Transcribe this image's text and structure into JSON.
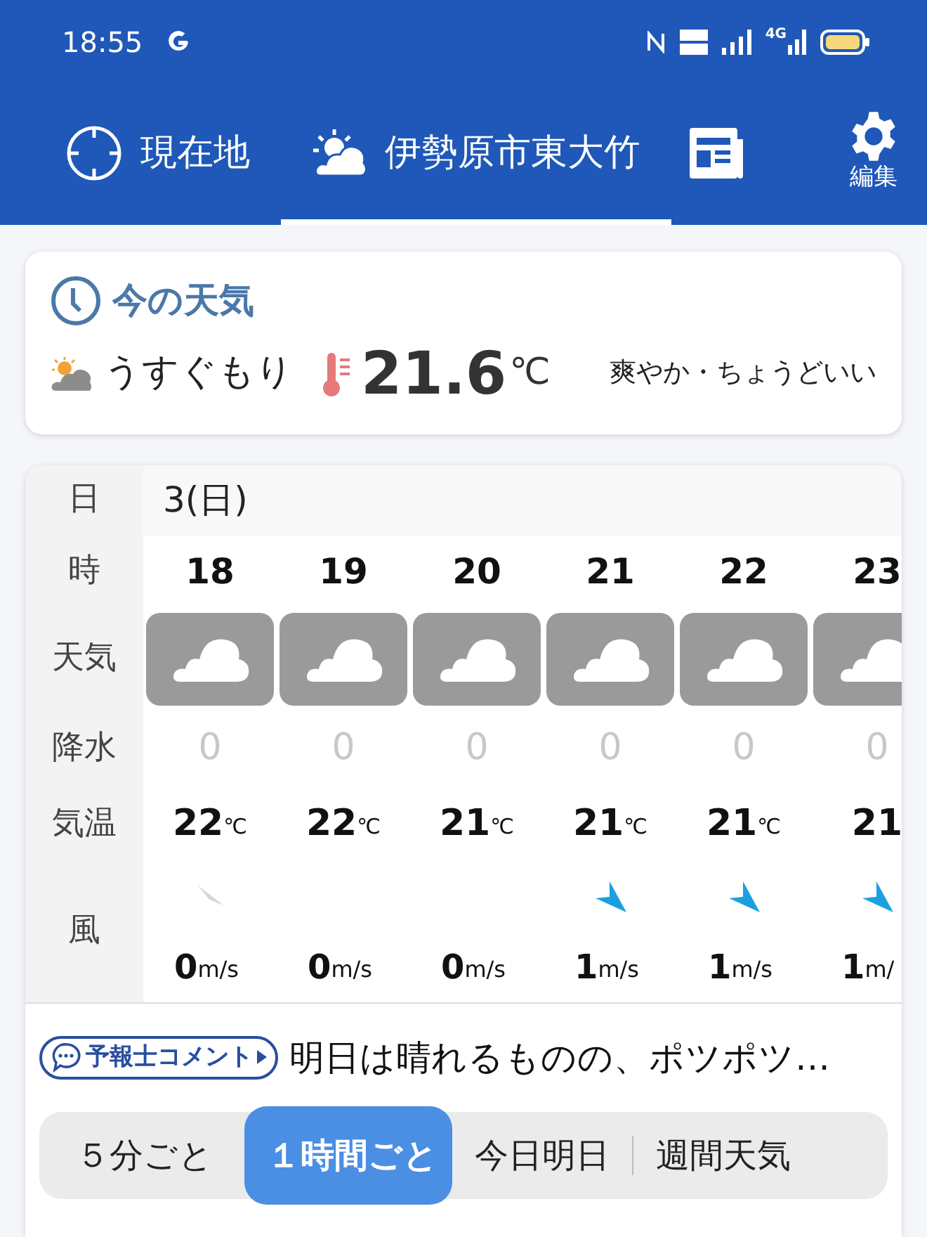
{
  "status_bar": {
    "time": "18:55",
    "network": "4G"
  },
  "tabs": [
    {
      "kind": "location",
      "label": "現在地",
      "selected": false
    },
    {
      "kind": "weather",
      "label": "伊勢原市東大竹",
      "selected": true
    },
    {
      "kind": "news",
      "selected": false
    }
  ],
  "edit_button": {
    "label": "編集"
  },
  "current": {
    "title": "今の天気",
    "condition": "うすぐもり",
    "temperature": "21.6",
    "unit": "℃",
    "feel": "爽やか・ちょうどいい"
  },
  "table": {
    "row_labels": [
      "日",
      "時",
      "天気",
      "降水",
      "気温",
      "風"
    ],
    "date": "3(日)",
    "hours": [
      {
        "hour": "18",
        "precip": "0",
        "temp": "22",
        "temp_unit": "℃",
        "kind": "calm",
        "speed": "0",
        "speed_unit": "m/s"
      },
      {
        "hour": "19",
        "precip": "0",
        "temp": "22",
        "temp_unit": "℃",
        "kind": "none",
        "speed": "0",
        "speed_unit": "m/s"
      },
      {
        "hour": "20",
        "precip": "0",
        "temp": "21",
        "temp_unit": "℃",
        "kind": "none",
        "speed": "0",
        "speed_unit": "m/s"
      },
      {
        "hour": "21",
        "precip": "0",
        "temp": "21",
        "temp_unit": "℃",
        "kind": "arrow",
        "speed": "1",
        "speed_unit": "m/s"
      },
      {
        "hour": "22",
        "precip": "0",
        "temp": "21",
        "temp_unit": "℃",
        "kind": "arrow",
        "speed": "1",
        "speed_unit": "m/s"
      },
      {
        "hour": "23",
        "precip": "0",
        "temp": "21",
        "kind": "arrow",
        "speed": "1",
        "speed_unit": "m/"
      }
    ]
  },
  "comment": {
    "badge": "予報士コメント",
    "text": "明日は晴れるものの、ポツポツ…"
  },
  "segments": [
    {
      "label": "５分ごと",
      "selected": false
    },
    {
      "label": "１時間ごと",
      "selected": true
    },
    {
      "label": "今日明日",
      "selected": false
    },
    {
      "label": "週間天気",
      "selected": false
    }
  ]
}
